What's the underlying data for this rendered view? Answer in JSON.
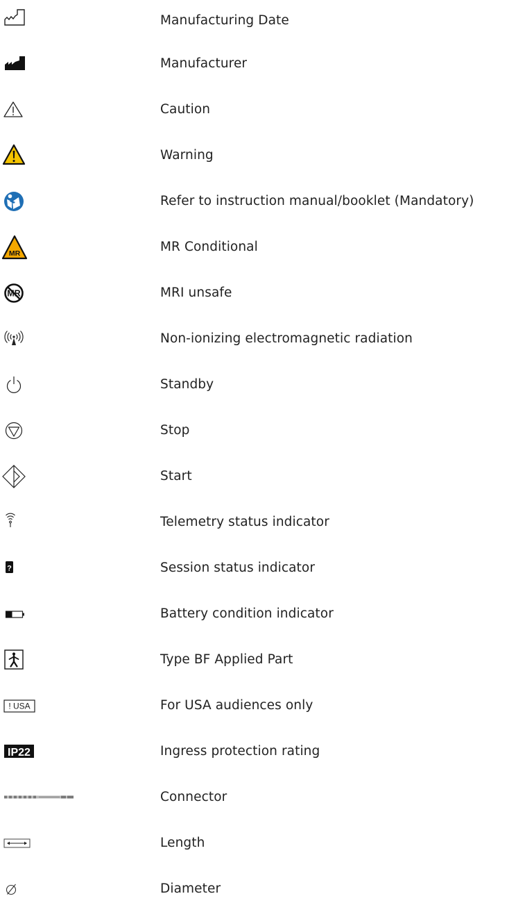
{
  "colors": {
    "text": "#222222",
    "warning_yellow": "#F5C400",
    "mandatory_blue": "#1F6FB5",
    "mr_orange": "#F5A800",
    "black": "#111111"
  },
  "symbols": [
    {
      "icon": "manufacturing-date-icon",
      "label": "Manufacturing Date"
    },
    {
      "icon": "manufacturer-icon",
      "label": "Manufacturer"
    },
    {
      "icon": "caution-icon",
      "label": "Caution"
    },
    {
      "icon": "warning-icon",
      "label": "Warning"
    },
    {
      "icon": "refer-to-manual-icon",
      "label": "Refer to instruction manual/booklet (Mandatory)"
    },
    {
      "icon": "mr-conditional-icon",
      "label": "MR Conditional",
      "icon_text": "MR"
    },
    {
      "icon": "mri-unsafe-icon",
      "label": "MRI unsafe",
      "icon_text": "MR"
    },
    {
      "icon": "non-ionizing-radiation-icon",
      "label": "Non-ionizing electromagnetic radiation"
    },
    {
      "icon": "standby-icon",
      "label": "Standby"
    },
    {
      "icon": "stop-icon",
      "label": "Stop"
    },
    {
      "icon": "start-icon",
      "label": "Start"
    },
    {
      "icon": "telemetry-status-icon",
      "label": "Telemetry status indicator"
    },
    {
      "icon": "session-status-icon",
      "label": "Session status indicator",
      "icon_text": "?"
    },
    {
      "icon": "battery-condition-icon",
      "label": "Battery condition indicator"
    },
    {
      "icon": "type-bf-applied-part-icon",
      "label": "Type BF Applied Part"
    },
    {
      "icon": "usa-audiences-icon",
      "label": "For USA audiences only",
      "icon_text": "! USA"
    },
    {
      "icon": "ip22-icon",
      "label": "Ingress protection rating",
      "icon_text": "IP22"
    },
    {
      "icon": "connector-icon",
      "label": "Connector"
    },
    {
      "icon": "length-icon",
      "label": "Length"
    },
    {
      "icon": "diameter-icon",
      "label": "Diameter"
    }
  ]
}
